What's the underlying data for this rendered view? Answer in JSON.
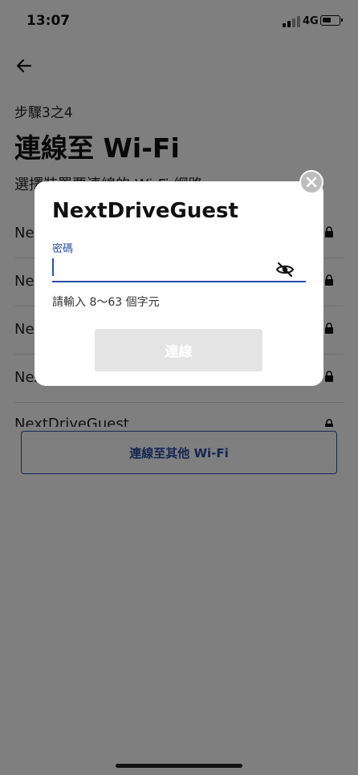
{
  "status_bar": {
    "time": "13:07",
    "network": "4G"
  },
  "header": {
    "step": "步驟3之4",
    "title": "連線至 Wi-Fi",
    "subtitle": "選擇裝置要連線的 Wi-Fi 網路"
  },
  "wifi_list": {
    "items": [
      {
        "name": "NextDriveGuest"
      },
      {
        "name": "NextDriveGuest"
      },
      {
        "name": "NextDriveGuest"
      },
      {
        "name": "NextDriveGuest"
      },
      {
        "name": "NextDriveGuest"
      }
    ]
  },
  "buttons": {
    "other_wifi": "連線至其他 Wi-Fi"
  },
  "modal": {
    "title": "NextDriveGuest",
    "password_label": "密碼",
    "password_value": "",
    "hint": "請輸入 8～63 個字元",
    "connect": "連線"
  },
  "colors": {
    "accent": "#2a4fa3",
    "overlay": "rgba(0,0,0,0.5)",
    "disabled": "#e4e4e4"
  }
}
